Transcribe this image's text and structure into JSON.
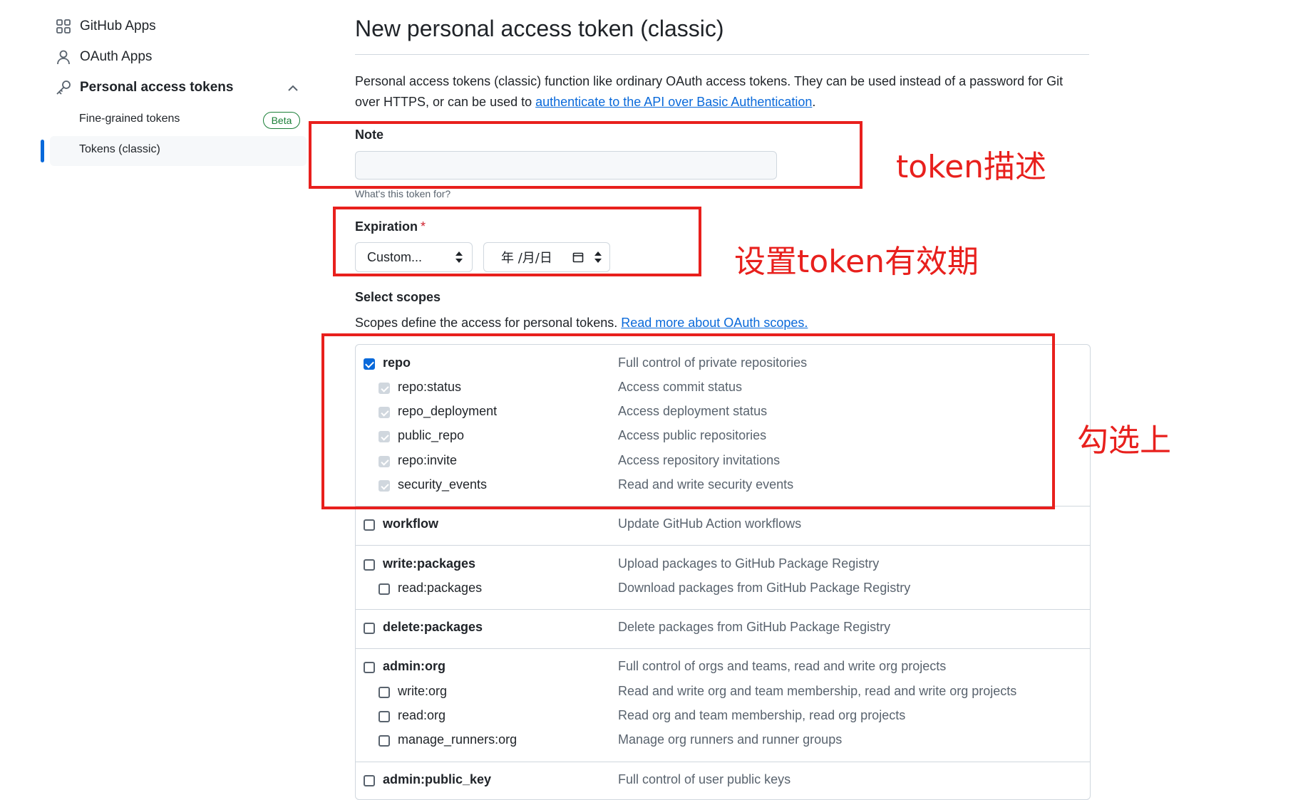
{
  "sidebar": {
    "items": [
      {
        "label": "GitHub Apps",
        "icon": "apps-grid-icon"
      },
      {
        "label": "OAuth Apps",
        "icon": "person-icon"
      },
      {
        "label": "Personal access tokens",
        "icon": "key-icon"
      }
    ],
    "sub_items": [
      {
        "label": "Fine-grained tokens",
        "badge": "Beta"
      },
      {
        "label": "Tokens (classic)",
        "active": true
      }
    ]
  },
  "page": {
    "title": "New personal access token (classic)",
    "intro_text": "Personal access tokens (classic) function like ordinary OAuth access tokens. They can be used instead of a password for Git over HTTPS, or can be used to ",
    "intro_link": "authenticate to the API over Basic Authentication",
    "intro_end": "."
  },
  "note": {
    "label": "Note",
    "value": "",
    "hint": "What's this token for?"
  },
  "expiration": {
    "label": "Expiration",
    "required_mark": "*",
    "selected": "Custom...",
    "date_placeholder": "年 /月/日"
  },
  "scopes": {
    "title": "Select scopes",
    "description": "Scopes define the access for personal tokens. ",
    "link": "Read more about OAuth scopes.",
    "rows": [
      {
        "name": "repo",
        "desc": "Full control of private repositories",
        "level": 0,
        "state": "checked"
      },
      {
        "name": "repo:status",
        "desc": "Access commit status",
        "level": 1,
        "state": "disabled"
      },
      {
        "name": "repo_deployment",
        "desc": "Access deployment status",
        "level": 1,
        "state": "disabled"
      },
      {
        "name": "public_repo",
        "desc": "Access public repositories",
        "level": 1,
        "state": "disabled"
      },
      {
        "name": "repo:invite",
        "desc": "Access repository invitations",
        "level": 1,
        "state": "disabled"
      },
      {
        "name": "security_events",
        "desc": "Read and write security events",
        "level": 1,
        "state": "disabled"
      },
      {
        "name": "workflow",
        "desc": "Update GitHub Action workflows",
        "level": 0,
        "state": "unchecked"
      },
      {
        "name": "write:packages",
        "desc": "Upload packages to GitHub Package Registry",
        "level": 0,
        "state": "unchecked"
      },
      {
        "name": "read:packages",
        "desc": "Download packages from GitHub Package Registry",
        "level": 1,
        "state": "unchecked"
      },
      {
        "name": "delete:packages",
        "desc": "Delete packages from GitHub Package Registry",
        "level": 0,
        "state": "unchecked"
      },
      {
        "name": "admin:org",
        "desc": "Full control of orgs and teams, read and write org projects",
        "level": 0,
        "state": "unchecked"
      },
      {
        "name": "write:org",
        "desc": "Read and write org and team membership, read and write org projects",
        "level": 1,
        "state": "unchecked"
      },
      {
        "name": "read:org",
        "desc": "Read org and team membership, read org projects",
        "level": 1,
        "state": "unchecked"
      },
      {
        "name": "manage_runners:org",
        "desc": "Manage org runners and runner groups",
        "level": 1,
        "state": "unchecked"
      },
      {
        "name": "admin:public_key",
        "desc": "Full control of user public keys",
        "level": 0,
        "state": "unchecked"
      }
    ]
  },
  "annotations": {
    "note": "token描述",
    "expiration": "设置token有效期",
    "scopes": "勾选上",
    "color": "#e8201d"
  }
}
